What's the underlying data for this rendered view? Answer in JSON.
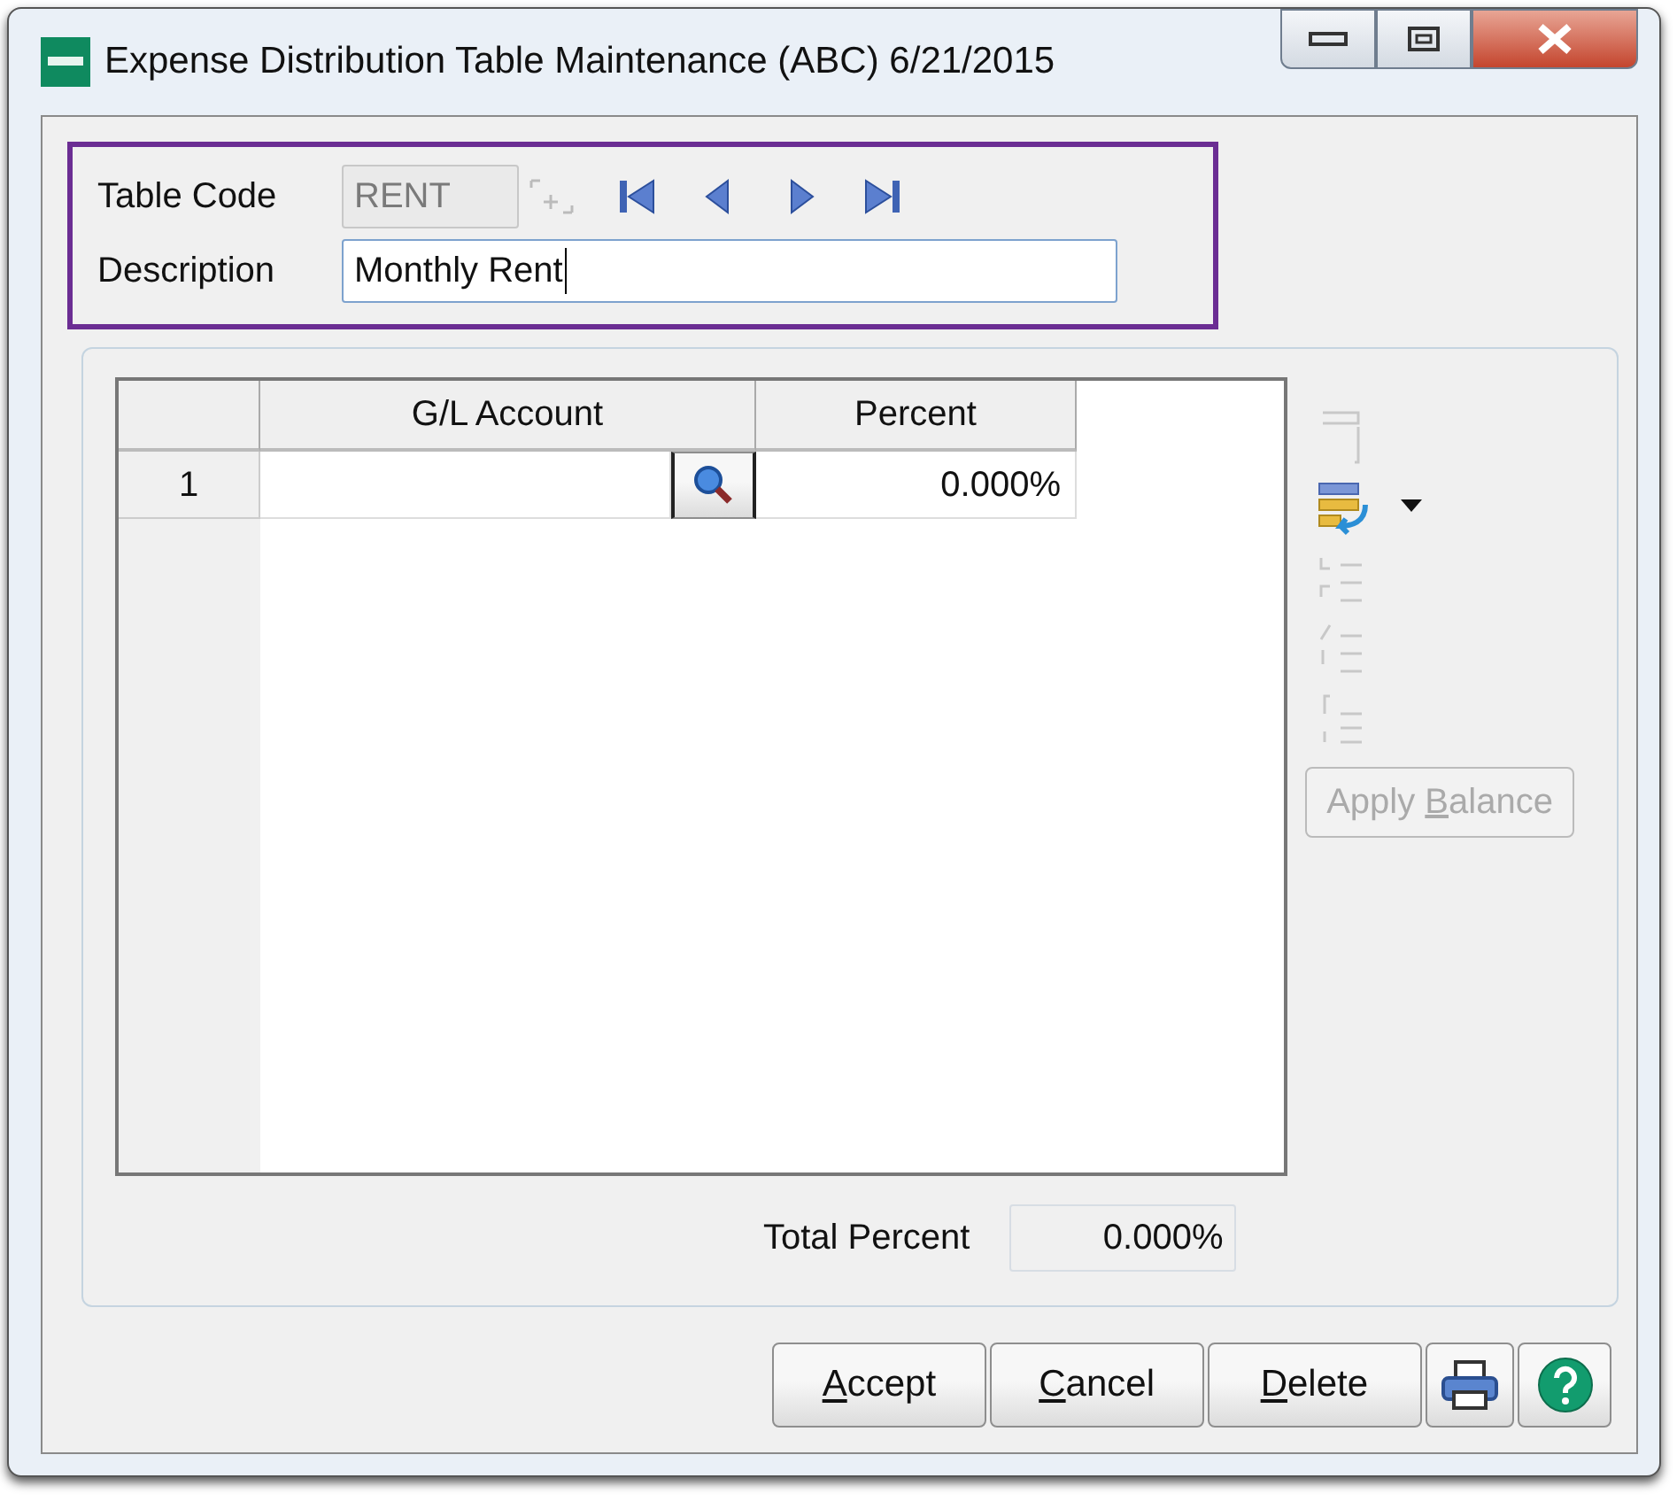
{
  "window": {
    "title": "Expense Distribution Table Maintenance (ABC) 6/21/2015",
    "controls": [
      {
        "kind": "minimize"
      },
      {
        "kind": "maximize"
      },
      {
        "kind": "close"
      }
    ]
  },
  "header": {
    "highlighted": true,
    "table_code": {
      "label": "Table Code",
      "value": "RENT",
      "disabled": true
    },
    "nav": [
      {
        "kind": "first"
      },
      {
        "kind": "prev"
      },
      {
        "kind": "next"
      },
      {
        "kind": "last"
      }
    ],
    "description": {
      "label": "Description",
      "value": "Monthly Rent",
      "focused": true
    }
  },
  "table": {
    "columns": [
      "G/L Account",
      "Percent"
    ],
    "rows": [
      {
        "number": "1",
        "gl_account": "",
        "percent": "0.000%"
      }
    ]
  },
  "toolbar": [
    {
      "kind": "blank",
      "disabled": true
    },
    {
      "kind": "insert",
      "disabled": false,
      "dropdown": true
    },
    {
      "kind": "indent",
      "disabled": true
    },
    {
      "kind": "split",
      "disabled": true
    },
    {
      "kind": "merge",
      "disabled": true
    }
  ],
  "apply_balance": {
    "before": "Apply ",
    "key": "B",
    "after": "alance",
    "disabled": true
  },
  "total": {
    "label": "Total Percent",
    "value": "0.000%"
  },
  "buttons": [
    {
      "kind": "text",
      "key": "A",
      "after": "ccept"
    },
    {
      "kind": "text",
      "key": "C",
      "after": "ancel"
    },
    {
      "kind": "text",
      "key": "D",
      "after": "elete"
    },
    {
      "kind": "print"
    },
    {
      "kind": "help"
    }
  ]
}
